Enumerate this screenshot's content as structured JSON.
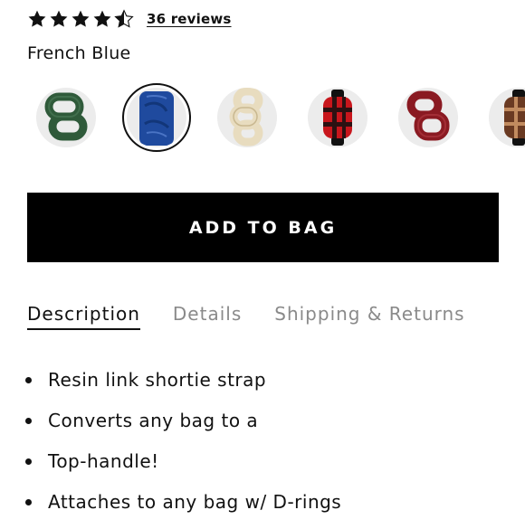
{
  "rating": {
    "value": 4.5,
    "max": 5,
    "reviews_label": "36 reviews"
  },
  "color": {
    "selected_name": "French Blue"
  },
  "swatches": [
    {
      "icon": "dark-green-link-strap-swatch",
      "color": "#2f5a3a",
      "selected": false
    },
    {
      "icon": "french-blue-link-strap-swatch",
      "color": "#1f4a9e",
      "selected": true
    },
    {
      "icon": "ivory-link-strap-swatch",
      "color": "#e8dcbf",
      "selected": false
    },
    {
      "icon": "red-plaid-link-strap-swatch",
      "color": "#c8161c",
      "selected": false
    },
    {
      "icon": "burgundy-link-strap-swatch",
      "color": "#8a1a22",
      "selected": false
    },
    {
      "icon": "tortoise-link-strap-swatch",
      "color": "#6a3a22",
      "selected": false
    }
  ],
  "cta": {
    "label": "ADD TO BAG"
  },
  "tabs": [
    {
      "label": "Description",
      "active": true
    },
    {
      "label": "Details",
      "active": false
    },
    {
      "label": "Shipping & Returns",
      "active": false
    }
  ],
  "description": {
    "bullets": [
      "Resin link shortie strap",
      "Converts any bag to a",
      "Top-handle!",
      "Attaches to any bag w/ D-rings"
    ]
  }
}
